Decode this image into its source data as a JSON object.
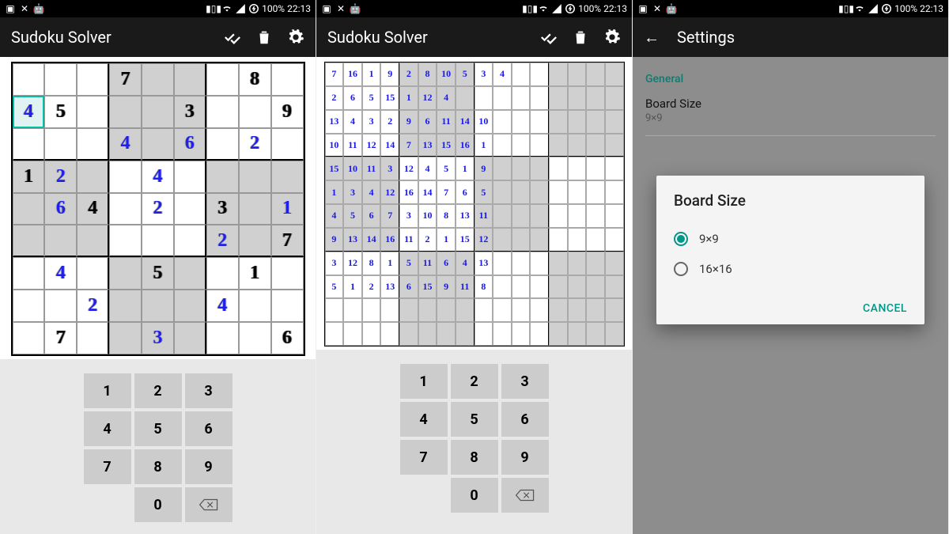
{
  "status": {
    "battery": "100%",
    "time": "22:13"
  },
  "app": {
    "title": "Sudoku Solver"
  },
  "keypad": {
    "k1": "1",
    "k2": "2",
    "k3": "3",
    "k4": "4",
    "k5": "5",
    "k6": "6",
    "k7": "7",
    "k8": "8",
    "k9": "9",
    "k0": "0"
  },
  "board9": {
    "selected": [
      1,
      0
    ],
    "cells": [
      [
        null,
        null,
        null,
        {
          "v": "7",
          "g": true
        },
        null,
        null,
        null,
        {
          "v": "8",
          "g": true
        },
        null
      ],
      [
        {
          "v": "4"
        },
        {
          "v": "5",
          "g": true
        },
        null,
        null,
        null,
        {
          "v": "3",
          "g": true
        },
        null,
        null,
        {
          "v": "9",
          "g": true
        }
      ],
      [
        null,
        null,
        null,
        {
          "v": "4"
        },
        null,
        {
          "v": "6"
        },
        null,
        {
          "v": "2"
        },
        null
      ],
      [
        {
          "v": "1",
          "g": true
        },
        {
          "v": "2"
        },
        null,
        null,
        {
          "v": "4"
        },
        null,
        null,
        null,
        null
      ],
      [
        null,
        {
          "v": "6"
        },
        {
          "v": "4",
          "g": true
        },
        null,
        {
          "v": "2"
        },
        null,
        {
          "v": "3",
          "g": true
        },
        null,
        {
          "v": "1"
        }
      ],
      [
        null,
        null,
        null,
        null,
        null,
        null,
        {
          "v": "2"
        },
        null,
        {
          "v": "7",
          "g": true
        }
      ],
      [
        null,
        {
          "v": "4"
        },
        null,
        null,
        {
          "v": "5",
          "g": true
        },
        null,
        null,
        {
          "v": "1",
          "g": true
        },
        null
      ],
      [
        null,
        null,
        {
          "v": "2"
        },
        null,
        null,
        null,
        {
          "v": "4"
        },
        null,
        null
      ],
      [
        null,
        {
          "v": "7",
          "g": true
        },
        null,
        null,
        {
          "v": "3"
        },
        null,
        null,
        null,
        {
          "v": "6",
          "g": true
        }
      ]
    ]
  },
  "board16": {
    "rows_visible": 12,
    "cells": [
      [
        "7",
        "16",
        "1",
        "9",
        "2",
        "8",
        "10",
        "5",
        "3",
        "4",
        "",
        "",
        "",
        "",
        "",
        ""
      ],
      [
        "2",
        "6",
        "5",
        "15",
        "1",
        "12",
        "4",
        "",
        "",
        "",
        "",
        "",
        "",
        "",
        "",
        ""
      ],
      [
        "13",
        "4",
        "3",
        "2",
        "9",
        "6",
        "11",
        "14",
        "10",
        "",
        "",
        "",
        "",
        "",
        "",
        ""
      ],
      [
        "10",
        "11",
        "12",
        "14",
        "7",
        "13",
        "15",
        "16",
        "1",
        "",
        "",
        "",
        "",
        "",
        "",
        ""
      ],
      [
        "15",
        "10",
        "11",
        "3",
        "12",
        "4",
        "5",
        "1",
        "9",
        "",
        "",
        "",
        "",
        "",
        "",
        ""
      ],
      [
        "1",
        "3",
        "4",
        "12",
        "16",
        "14",
        "7",
        "6",
        "5",
        "",
        "",
        "",
        "",
        "",
        "",
        ""
      ],
      [
        "4",
        "5",
        "6",
        "7",
        "3",
        "10",
        "8",
        "13",
        "11",
        "",
        "",
        "",
        "",
        "",
        "",
        ""
      ],
      [
        "9",
        "13",
        "14",
        "16",
        "11",
        "2",
        "1",
        "15",
        "12",
        "",
        "",
        "",
        "",
        "",
        "",
        ""
      ],
      [
        "3",
        "12",
        "8",
        "1",
        "5",
        "11",
        "6",
        "4",
        "13",
        "",
        "",
        "",
        "",
        "",
        "",
        ""
      ],
      [
        "5",
        "1",
        "2",
        "13",
        "6",
        "15",
        "9",
        "11",
        "8",
        "",
        "",
        "",
        "",
        "",
        "",
        ""
      ],
      [
        "",
        "",
        "",
        "",
        "",
        "",
        "",
        "",
        "",
        "",
        "",
        "",
        "",
        "",
        "",
        ""
      ],
      [
        "",
        "",
        "",
        "",
        "",
        "",
        "",
        "",
        "",
        "",
        "",
        "",
        "",
        "",
        "",
        ""
      ]
    ]
  },
  "settings": {
    "title": "Settings",
    "general_header": "General",
    "board_size_label": "Board Size",
    "board_size_value": "9×9"
  },
  "dialog": {
    "title": "Board Size",
    "option1": "9×9",
    "option2": "16×16",
    "selected": "9×9",
    "cancel": "CANCEL"
  }
}
